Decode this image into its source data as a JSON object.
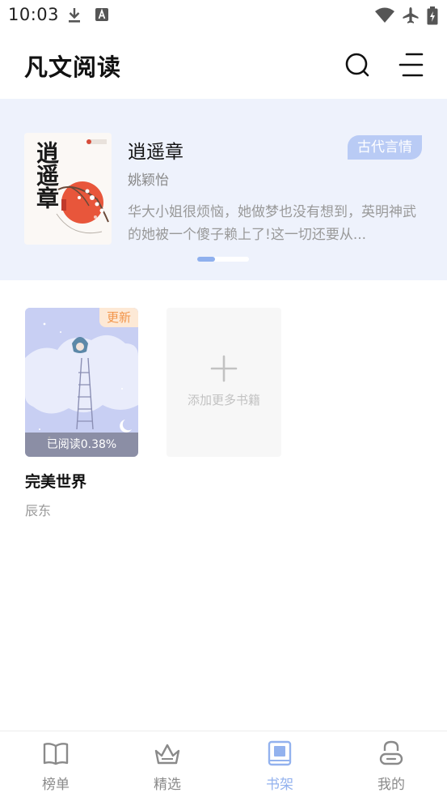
{
  "status_bar": {
    "time": "10:03",
    "icons": [
      "download-icon",
      "app-notification-icon",
      "wifi-icon",
      "airplane-icon",
      "battery-icon"
    ]
  },
  "header": {
    "title": "凡文阅读",
    "actions": [
      "search-icon",
      "menu-icon"
    ]
  },
  "banner": {
    "title": "逍遥章",
    "author": "姚颖怡",
    "tag": "古代言情",
    "description": "华大小姐很烦恼，她做梦也没有想到，英明神武的她被一个傻子赖上了!这一切还要从...",
    "slide_index": 1,
    "slide_count": 3,
    "cover_text": "逍遥章"
  },
  "shelf": {
    "books": [
      {
        "title": "完美世界",
        "author": "辰东",
        "badge": "更新",
        "progress_label": "已阅读0.38%"
      }
    ],
    "add_label": "添加更多书籍"
  },
  "bottom_nav": {
    "items": [
      {
        "label": "榜单",
        "icon": "book-open-icon",
        "active": false
      },
      {
        "label": "精选",
        "icon": "crown-icon",
        "active": false
      },
      {
        "label": "书架",
        "icon": "bookshelf-icon",
        "active": true
      },
      {
        "label": "我的",
        "icon": "user-icon",
        "active": false
      }
    ]
  },
  "colors": {
    "accent": "#93b2ee",
    "banner_bg": "#eef2fc",
    "tag_bg": "#b9cbf5",
    "badge_text": "#f2954a",
    "badge_bg": "#fde9d6"
  }
}
